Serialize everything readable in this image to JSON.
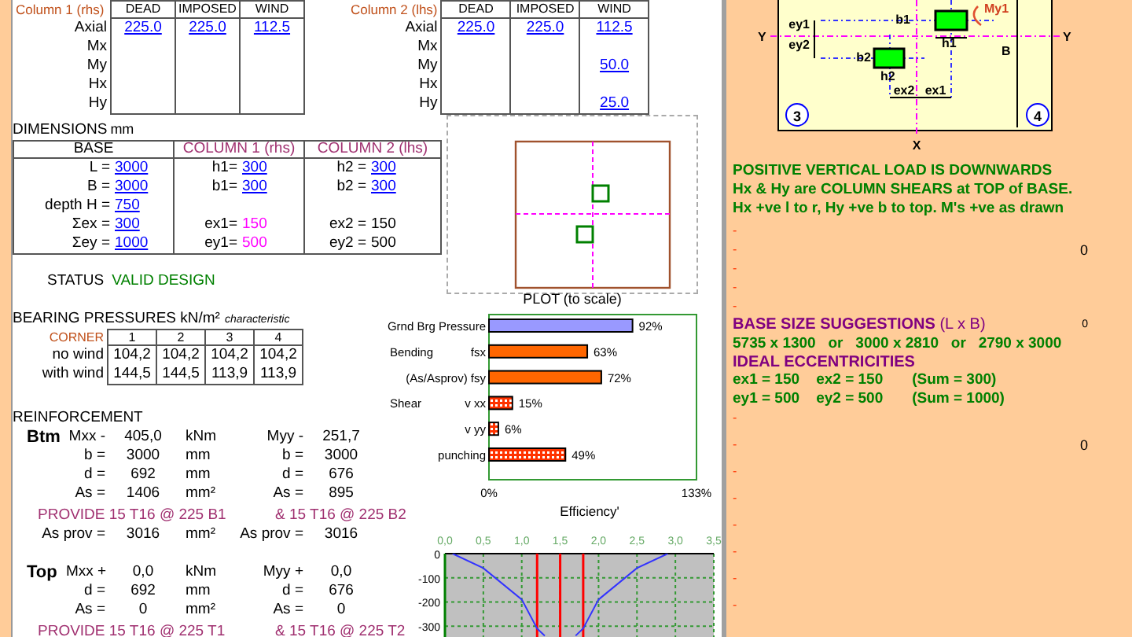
{
  "loads": [
    {
      "heading": "Column 1 (rhs)",
      "columns": [
        "DEAD",
        "IMPOSED",
        "WIND"
      ],
      "rows": [
        {
          "label": "Axial",
          "dead": "225.0",
          "imposed": "225.0",
          "wind": "112.5"
        },
        {
          "label": "Mx"
        },
        {
          "label": "My"
        },
        {
          "label": "Hx"
        },
        {
          "label": "Hy"
        }
      ]
    },
    {
      "heading": "Column 2 (lhs)",
      "columns": [
        "DEAD",
        "IMPOSED",
        "WIND"
      ],
      "rows": [
        {
          "label": "Axial",
          "dead": "225.0",
          "imposed": "225.0",
          "wind": "112.5"
        },
        {
          "label": "Mx"
        },
        {
          "label": "My",
          "wind": "50.0"
        },
        {
          "label": "Hx"
        },
        {
          "label": "Hy",
          "wind": "25.0"
        }
      ]
    }
  ],
  "dimensions": {
    "title": "DIMENSIONS",
    "unit": "mm",
    "columns": [
      "BASE",
      "COLUMN 1 (rhs)",
      "COLUMN 2 (lhs)"
    ],
    "rows": [
      [
        {
          "label": "L =",
          "value": "3000",
          "kind": "input"
        },
        {
          "label": "h1=",
          "value": "300",
          "kind": "input"
        },
        {
          "label": "h2 =",
          "value": "300",
          "kind": "input"
        }
      ],
      [
        {
          "label": "B =",
          "value": "3000",
          "kind": "input"
        },
        {
          "label": "b1=",
          "value": "300",
          "kind": "input"
        },
        {
          "label": "b2 =",
          "value": "300",
          "kind": "input"
        }
      ],
      [
        {
          "label": "depth H =",
          "value": "750",
          "kind": "input"
        }
      ],
      [
        {
          "label": "Σex =",
          "value": "300",
          "kind": "input"
        },
        {
          "label": "ex1=",
          "value": "150",
          "kind": "highlight"
        },
        {
          "label": "ex2 =",
          "value": "150",
          "kind": "plain"
        }
      ],
      [
        {
          "label": "Σey =",
          "value": "1000",
          "kind": "input"
        },
        {
          "label": "ey1=",
          "value": "500",
          "kind": "highlight"
        },
        {
          "label": "ey2 =",
          "value": "500",
          "kind": "plain"
        }
      ]
    ]
  },
  "status": {
    "label": "STATUS",
    "value": "VALID DESIGN"
  },
  "plot": {
    "caption": "PLOT (to scale)"
  },
  "bearing": {
    "title": "BEARING PRESSURES kN/m²",
    "note": "characteristic",
    "corner_label": "CORNER",
    "corners": [
      "1",
      "2",
      "3",
      "4"
    ],
    "rows": [
      {
        "label": "no wind",
        "values": [
          "104,2",
          "104,2",
          "104,2",
          "104,2"
        ]
      },
      {
        "label": "with wind",
        "values": [
          "144,5",
          "144,5",
          "113,9",
          "113,9"
        ]
      }
    ]
  },
  "reinforcement": {
    "title": "REINFORCEMENT",
    "blocks": [
      {
        "tag": "Btm",
        "rows": [
          [
            "Mxx -",
            "405,0",
            "kNm",
            "Myy -",
            "251,7"
          ],
          [
            "b =",
            "3000",
            "mm",
            "b =",
            "3000"
          ],
          [
            "d =",
            "692",
            "mm",
            "d =",
            "676"
          ],
          [
            "As =",
            "1406",
            "mm²",
            "As =",
            "895"
          ]
        ],
        "provide": [
          "PROVIDE 15 T16 @ 225 B1",
          "& 15 T16 @ 225 B2"
        ],
        "as_prov": [
          "As prov =",
          "3016",
          "mm²",
          "As prov =",
          "3016"
        ]
      },
      {
        "tag": "Top",
        "rows": [
          [
            "Mxx +",
            "0,0",
            "kNm",
            "Myy +",
            "0,0"
          ],
          [
            "d =",
            "692",
            "mm",
            "d =",
            "676"
          ],
          [
            "As =",
            "0",
            "mm²",
            "As =",
            "0"
          ]
        ],
        "provide": [
          "PROVIDE 15 T16 @ 225 T1",
          "& 15 T16 @ 225 T2"
        ]
      }
    ]
  },
  "efficiency": {
    "rows": [
      {
        "kind": "solid",
        "color": "#9999ff"
      },
      {
        "group": "Bending",
        "kind": "solid",
        "color": "#ff6600"
      },
      {
        "kind": "solid",
        "color": "#ff6600"
      },
      {
        "group": "Shear",
        "kind": "hatched",
        "color": "#ff3300"
      },
      {
        "kind": "hatched",
        "color": "#ff3300"
      },
      {
        "kind": "hatched",
        "color": "#ff3300"
      }
    ],
    "chart_data": {
      "type": "bar",
      "orientation": "horizontal",
      "xlabel": "Efficiency'",
      "categories": [
        "Grnd Brg Pressure",
        "fsx",
        "(As/Asprov) fsy",
        "v xx",
        "v yy",
        "punching"
      ],
      "values": [
        92,
        63,
        72,
        15,
        6,
        49
      ],
      "value_labels": [
        "92%",
        "63%",
        "72%",
        "15%",
        "6%",
        "49%"
      ],
      "xlim": [
        0,
        133
      ],
      "xticks": [
        {
          "value": 0,
          "label": "0%"
        },
        {
          "value": 133,
          "label": "133%"
        }
      ]
    }
  },
  "moment_chart": {
    "chart_data": {
      "type": "line",
      "grid": true,
      "x": [
        0.1,
        0.5,
        1.0,
        1.2,
        1.3,
        1.5,
        1.7,
        1.8,
        2.0,
        2.5,
        2.9
      ],
      "values": [
        0,
        -60,
        -190,
        -310,
        -340,
        null,
        -340,
        -310,
        -190,
        -60,
        0
      ],
      "xlim": [
        0,
        3.5
      ],
      "ylim": [
        -345,
        0
      ],
      "xticks": [
        {
          "value": 0,
          "label": "0,0"
        },
        {
          "value": 0.5,
          "label": "0,5"
        },
        {
          "value": 1,
          "label": "1,0"
        },
        {
          "value": 1.5,
          "label": "1,5"
        },
        {
          "value": 2,
          "label": "2,0"
        },
        {
          "value": 2.5,
          "label": "2,5"
        },
        {
          "value": 3,
          "label": "3,0"
        },
        {
          "value": 3.5,
          "label": "3,5"
        }
      ],
      "yticks": [
        {
          "value": 0,
          "label": "0"
        },
        {
          "value": -100,
          "label": "-100"
        },
        {
          "value": -200,
          "label": "-200"
        },
        {
          "value": -300,
          "label": "-300"
        }
      ],
      "ref_lines": [
        {
          "axis": "x",
          "value": 1.2
        },
        {
          "axis": "x",
          "value": 1.5
        },
        {
          "axis": "x",
          "value": 1.8
        }
      ]
    }
  },
  "diagram": {
    "labels": {
      "y_left": "Y",
      "y_right": "Y",
      "x": "X",
      "ey1": "ey1",
      "ey2": "ey2",
      "b1": "b1",
      "h1": "h1",
      "b2": "b2",
      "h2": "h2",
      "ex2": "ex2",
      "ex1": "ex1",
      "B": "B",
      "moment": "My1",
      "corner_3": "3",
      "corner_4": "4"
    }
  },
  "notes": [
    "POSITIVE VERTICAL LOAD IS DOWNWARDS",
    "Hx & Hy are COLUMN SHEARS at TOP of BASE.",
    "Hx +ve l to r, Hy +ve b to top. M's +ve as drawn"
  ],
  "markers_upper": [
    {
      "mark": "-"
    },
    {
      "mark": "-",
      "value": "0"
    },
    {
      "mark": "-"
    },
    {
      "mark": "-"
    },
    {
      "mark": "-"
    }
  ],
  "suggestions": {
    "heading": "**BASE SIZE SUGGESTIONS** (L x B)",
    "value": "0",
    "line": "5735 x 1300   or   3000 x 2810   or   2790 x 3000"
  },
  "eccentricities": {
    "heading": "IDEAL ECCENTRICITIES",
    "lines": [
      "ex1 = 150    ex2 = 150       (Sum = 300)",
      "ey1 = 500    ey2 = 500       (Sum = 1000)"
    ]
  },
  "markers_lower": [
    {
      "mark": "-"
    },
    {
      "mark": "-",
      "value": "0"
    },
    {
      "mark": "-"
    },
    {
      "mark": "-"
    },
    {
      "mark": "-"
    },
    {
      "mark": "-"
    },
    {
      "mark": "-"
    },
    {
      "mark": "-"
    }
  ]
}
